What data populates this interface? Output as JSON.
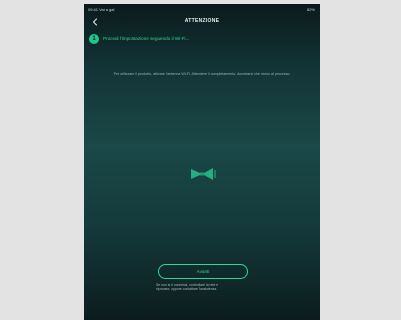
{
  "status_bar": {
    "left_text": "09:41  Vai a gal",
    "right_text": "82%"
  },
  "nav": {
    "back_icon": "chevron-left-icon",
    "title": "ATTENZIONE"
  },
  "step": {
    "number": "1",
    "text": "Procedi l'impostazione seguendo il Wi-Fi..."
  },
  "description": "Per utilizzare il prodotto, attivare l'antenna Wi-Fi. Attendere il completamento. Accertarsi che vicino al processo.",
  "main_icon": "speaker-wave-icon",
  "accent_color": "#2fd694",
  "button": {
    "label": "Avanti"
  },
  "hint": {
    "line1": "Se non si è connessi, controllare la rete e",
    "line2": "riprovare, oppure contattare l'assistenza."
  }
}
